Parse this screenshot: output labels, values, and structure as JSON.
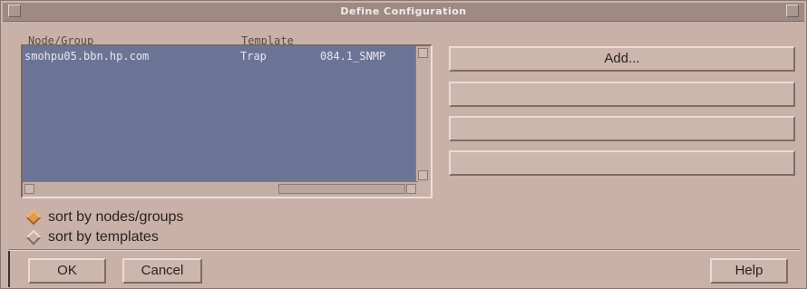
{
  "window": {
    "title": "Define Configuration"
  },
  "list": {
    "headers": [
      "Node/Group",
      "Template"
    ],
    "rows": [
      {
        "node": "smohpu05.bbn.hp.com",
        "type": "Trap",
        "template": "084.1_SNMP"
      }
    ]
  },
  "side_buttons": [
    "Add...",
    "",
    "",
    ""
  ],
  "sort": {
    "options": [
      {
        "label": "sort by nodes/groups",
        "selected": true
      },
      {
        "label": "sort by templates",
        "selected": false
      }
    ]
  },
  "buttons": {
    "ok": "OK",
    "cancel": "Cancel",
    "help": "Help"
  },
  "colors": {
    "list_bg": "#6c7496",
    "window_bg": "#c9b1a7",
    "radio_selected": "#e09a4a"
  }
}
